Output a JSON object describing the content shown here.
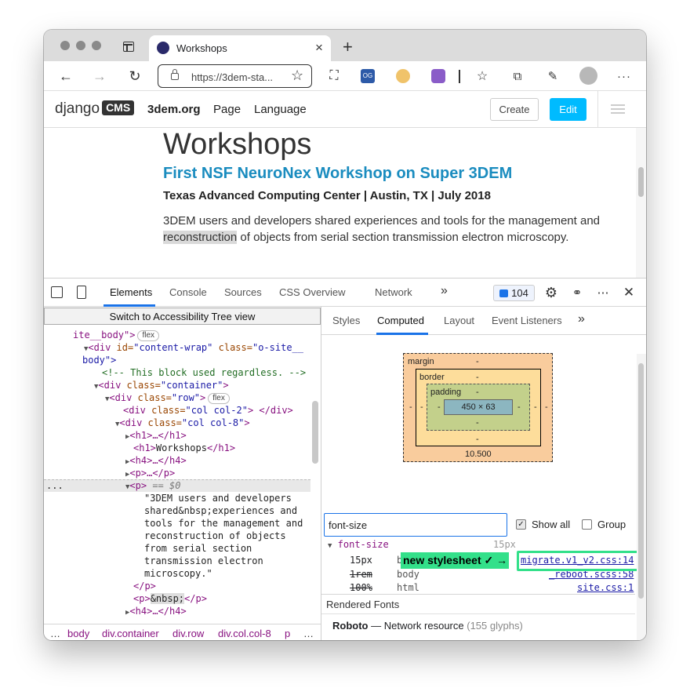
{
  "browser": {
    "tab_title": "Workshops",
    "tab_close": "×",
    "new_tab": "+",
    "url": "https://3dem-sta..."
  },
  "site": {
    "logo_text": "django",
    "logo_badge": "CMS",
    "nav": [
      "3dem.org",
      "Page",
      "Language"
    ],
    "create_label": "Create",
    "edit_label": "Edit",
    "accent_color": "#00bbff"
  },
  "article": {
    "title": "Workshops",
    "subtitle": "First NSF NeuroNex Workshop on Super 3DEM",
    "meta": "Texas Advanced Computing Center | Austin, TX | July 2018",
    "para_before": "3DEM users and developers shared experiences and tools for the management and ",
    "para_highlight": "reconstruction",
    "para_after": " of objects from serial section transmission electron microscopy."
  },
  "devtools": {
    "tabs": [
      "Elements",
      "Console",
      "Sources",
      "CSS Overview",
      "Network"
    ],
    "more": "»",
    "issue_count": "104",
    "a11y_button": "Switch to Accessibility Tree view",
    "tree": {
      "l1_a": "ite__body\">",
      "l1_pill": "flex",
      "l2_tag": "<div ",
      "l2_attr": "id=",
      "l2_val": "\"content-wrap\"",
      "l2_attr2": " class=",
      "l2_val2": "\"o-site__",
      "l3": "body\">",
      "l4": "<!-- This block used regardless. -->",
      "l5_tag": "<div ",
      "l5_attr": "class=",
      "l5_val": "\"container\"",
      "l5_end": ">",
      "l6_tag": "<div ",
      "l6_attr": "class=",
      "l6_val": "\"row\"",
      "l6_end": ">",
      "l6_pill": "flex",
      "l7_tag": "<div ",
      "l7_attr": "class=",
      "l7_val": "\"col col-2\"",
      "l7_end": "> </div>",
      "l8_tag": "<div ",
      "l8_attr": "class=",
      "l8_val": "\"col col-8\"",
      "l8_end": ">",
      "l9": "<h1>…</h1>",
      "l10_open": "<h1>",
      "l10_text": "Workshops",
      "l10_close": "</h1>",
      "l11": "<h4>…</h4>",
      "l12": "<p>…</p>",
      "l13_tag": "<p>",
      "l13_eq": " == $0",
      "p_text": [
        "\"3DEM users and developers",
        "shared&nbsp;experiences and",
        "tools for the management and",
        "reconstruction of objects",
        "from serial section",
        "transmission electron",
        "microscopy.\""
      ],
      "p_close": "</p>",
      "l14_open": "<p>",
      "l14_text": "&nbsp;",
      "l14_close": "</p>",
      "l15": "<h4>…</h4>",
      "dots": "..."
    },
    "breadcrumbs": [
      "…",
      "body",
      "div.container",
      "div.row",
      "div.col.col-8",
      "p",
      "…"
    ],
    "sub_tabs": [
      "Styles",
      "Computed",
      "Layout",
      "Event Listeners"
    ],
    "box_model": {
      "margin_label": "margin",
      "border_label": "border",
      "padding_label": "padding",
      "dash": "-",
      "content": "450 × 63",
      "bottom_value": "10.500"
    },
    "filter_value": "font-size",
    "show_all_label": "Show all",
    "group_label": "Group",
    "computed": {
      "prop": "font-size",
      "value": "15px",
      "rows": [
        {
          "value": "15px",
          "selector": "b",
          "source": "migrate.v1_v2.css:14"
        },
        {
          "value": "1rem",
          "selector": "body",
          "source": "_reboot.scss:58"
        },
        {
          "value": "100%",
          "selector": "html",
          "source": "site.css:1"
        }
      ]
    },
    "callout": "new stylesheet ✓ →",
    "rendered_fonts_title": "Rendered Fonts",
    "font_name": "Roboto",
    "font_dash": "—",
    "font_source": "Network resource",
    "font_glyphs": "(155 glyphs)"
  }
}
